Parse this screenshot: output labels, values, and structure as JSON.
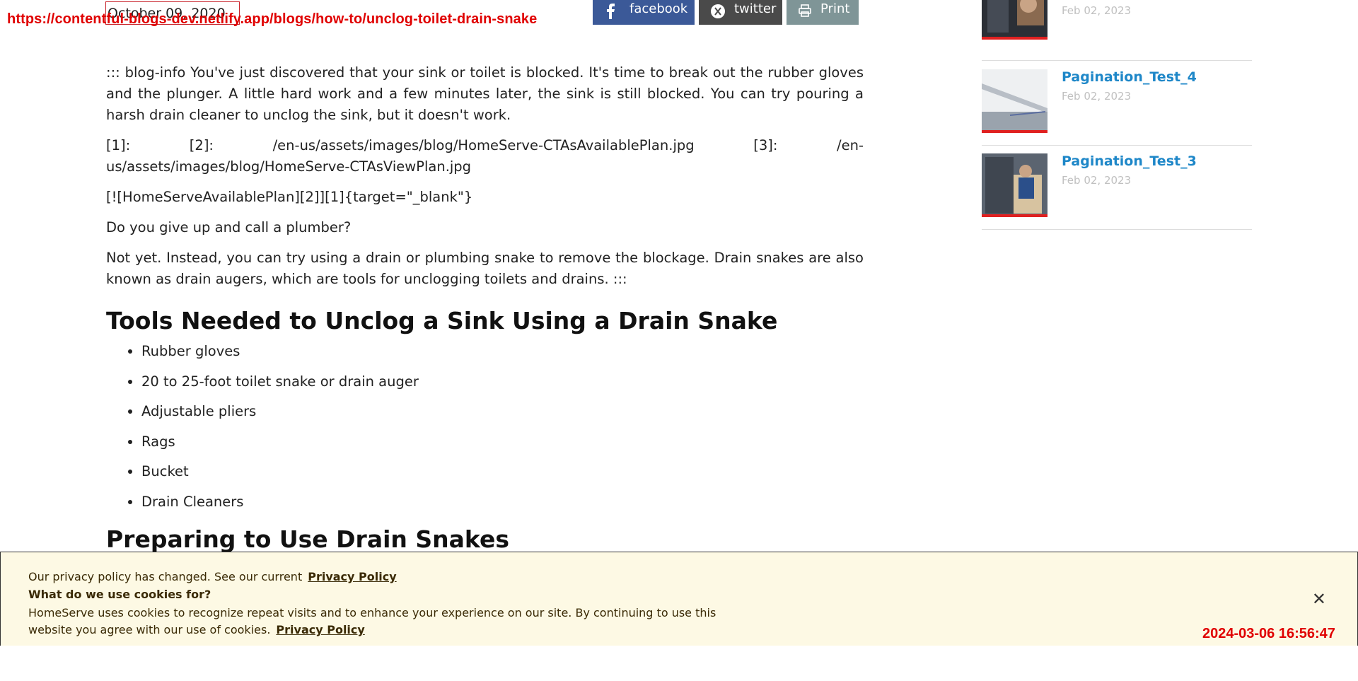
{
  "overlay": {
    "url": "https://contentful-blogs-dev.netlify.app/blogs/how-to/unclog-toilet-drain-snake",
    "timestamp": "2024-03-06 16:56:47"
  },
  "article": {
    "date": "October 09, 2020",
    "share": {
      "facebook": "facebook",
      "twitter": "twitter",
      "print": "Print"
    },
    "paragraphs": [
      "::: blog-info You've just discovered that your sink or toilet is blocked. It's time to break out the rubber gloves and the plunger. A little hard work and a few minutes later, the sink is still blocked. You can try pouring a harsh drain cleaner to unclog the sink, but it doesn't work.",
      "[1]: [2]: /en-us/assets/images/blog/HomeServe-CTAsAvailablePlan.jpg [3]: /en-us/assets/images/blog/HomeServe-CTAsViewPlan.jpg",
      "[![HomeServeAvailablePlan][2]][1]{target=\"_blank\"}",
      "Do you give up and call a plumber?",
      "Not yet. Instead, you can try using a drain or plumbing snake to remove the blockage. Drain snakes are also known as drain augers, which are tools for unclogging toilets and drains. :::"
    ],
    "heading1": "Tools Needed to Unclog a Sink Using a Drain Snake",
    "tools": [
      "Rubber gloves",
      "20 to 25-foot toilet snake or drain auger",
      "Adjustable pliers",
      "Rags",
      "Bucket",
      "Drain Cleaners"
    ],
    "heading2": "Preparing to Use Drain Snakes"
  },
  "sidebar": {
    "items": [
      {
        "title": "Pagination_Test_4",
        "date": "Feb 02, 2023"
      },
      {
        "title": "Pagination_Test_3",
        "date": "Feb 02, 2023"
      }
    ],
    "partial_item": {
      "date": "Feb 02, 2023"
    }
  },
  "cookie": {
    "line1": "Our privacy policy has changed. See our current",
    "link1": "Privacy Policy",
    "question": "What do we use cookies for?",
    "body": "HomeServe uses cookies to recognize repeat visits and to enhance your experience on our site. By continuing to use this website you agree with our use of cookies.",
    "link2": "Privacy Policy",
    "close_symbol": "✕"
  }
}
